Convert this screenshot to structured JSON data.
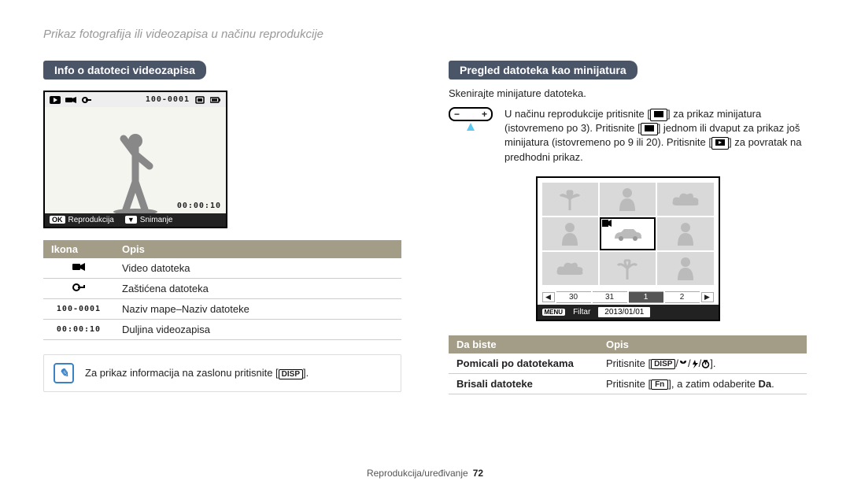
{
  "header": "Prikaz fotografija ili videozapisa u načinu reprodukcije",
  "left": {
    "heading": "Info o datoteci videozapisa",
    "lcd": {
      "file_label": "100-0001",
      "time": "00:00:10",
      "ok": "OK",
      "play": "Reprodukcija",
      "down": "▼",
      "capture": "Snimanje"
    },
    "table": {
      "h1": "Ikona",
      "h2": "Opis",
      "rows": [
        {
          "icon_name": "video-icon",
          "desc": "Video datoteka"
        },
        {
          "icon_name": "lock-icon",
          "desc": "Zaštićena datoteka"
        },
        {
          "icon_name": "folder-file-label",
          "icon_text": "100-0001",
          "desc": "Naziv mape–Naziv datoteke"
        },
        {
          "icon_name": "duration-label",
          "icon_text": "00:00:10",
          "desc": "Duljina videozapisa"
        }
      ]
    },
    "note_pre": "Za prikaz informacija na zaslonu pritisnite [",
    "note_key": "DISP",
    "note_post": "]."
  },
  "right": {
    "heading": "Pregled datoteka kao minijatura",
    "intro": "Skenirajte minijature datoteka.",
    "para_a": "U načinu reprodukcije pritisnite [",
    "para_b": "] za prikaz minijatura (istovremeno po 3). Pritisnite [",
    "para_c": "] jednom ili dvaput za prikaz još minijatura (istovremeno po 9 ili 20). Pritisnite [",
    "para_d": "] za povratak na predhodni prikaz.",
    "scroll": {
      "a": "30",
      "b": "31",
      "c": "1",
      "d": "2"
    },
    "filter_btn": "MENU",
    "filter_label": "Filtar",
    "filter_date": "2013/01/01",
    "table": {
      "h1": "Da biste",
      "h2": "Opis",
      "rows": [
        {
          "label": "Pomicali po datotekama",
          "pre": "Pritisnite [",
          "key": "DISP",
          "post": "/",
          "suffix": "]."
        },
        {
          "label": "Brisali datoteke",
          "pre": "Pritisnite [",
          "key": "Fn",
          "post": "], a zatim odaberite ",
          "bold": "Da",
          "suffix": "."
        }
      ]
    }
  },
  "footer": {
    "section": "Reprodukcija/uređivanje",
    "page": "72"
  }
}
